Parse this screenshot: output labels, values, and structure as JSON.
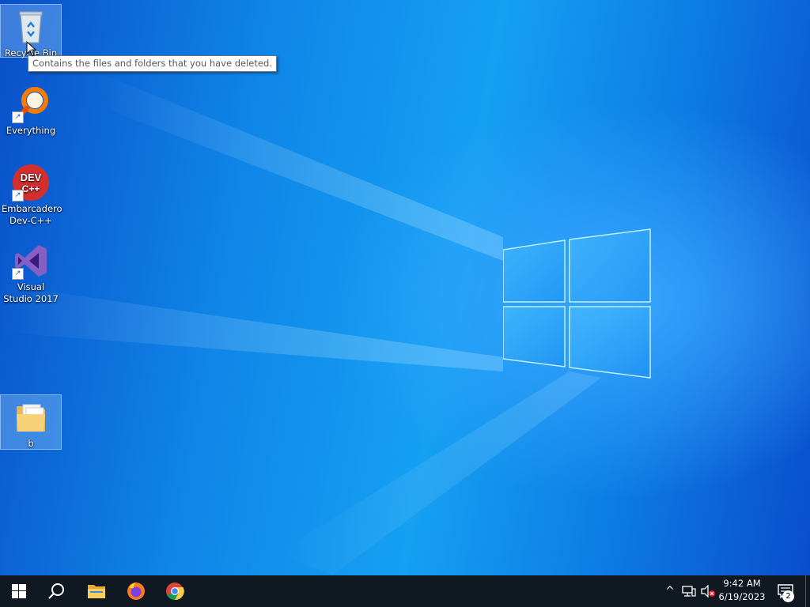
{
  "desktop": {
    "icons": [
      {
        "label": "Recycle Bin",
        "icon": "recycle-bin-icon"
      },
      {
        "label": "Everything",
        "icon": "everything-search-icon"
      },
      {
        "label": "Embarcadero Dev-C++",
        "icon": "dev-cpp-icon"
      },
      {
        "label": "Visual Studio 2017",
        "icon": "visual-studio-icon"
      },
      {
        "label": "b",
        "icon": "folder-icon"
      }
    ],
    "tooltip": "Contains the files and folders that you have deleted.",
    "icon_badge_text": "DEV\nC++"
  },
  "taskbar": {
    "buttons": [
      {
        "name": "start",
        "icon": "windows-start-icon"
      },
      {
        "name": "search",
        "icon": "search-icon"
      },
      {
        "name": "file-explorer",
        "icon": "folder-icon"
      },
      {
        "name": "firefox",
        "icon": "firefox-icon"
      },
      {
        "name": "chrome",
        "icon": "chrome-icon"
      }
    ],
    "tray": {
      "chevron": "^",
      "time": "9:42 AM",
      "date": "6/19/2023",
      "notification_count": "2"
    }
  },
  "colors": {
    "taskbar": "#101822",
    "accent": "#0f86e8"
  }
}
